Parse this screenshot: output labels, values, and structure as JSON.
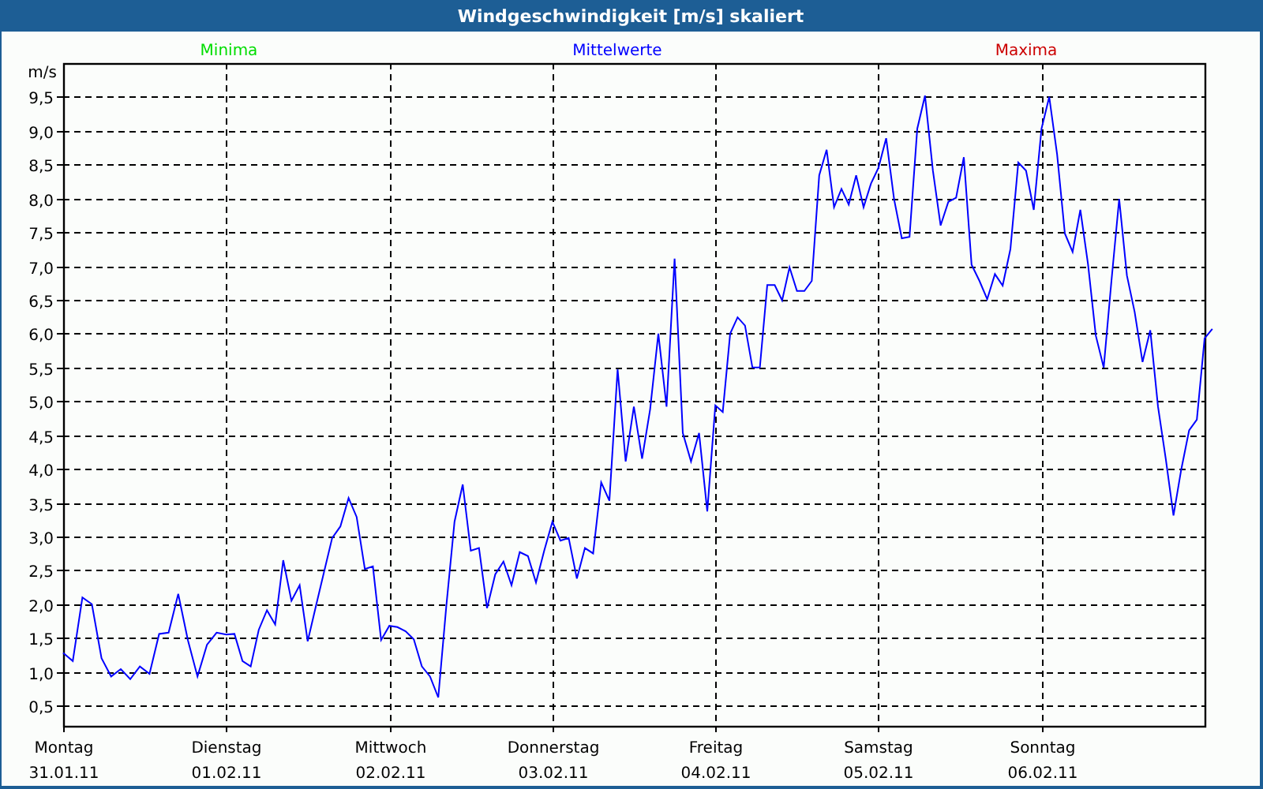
{
  "window": {
    "title": "Windgeschwindigkeit [m/s] skaliert"
  },
  "chart": {
    "legend": [
      {
        "name": "Minima",
        "color": "#00dd00"
      },
      {
        "name": "Mittelwerte",
        "color": "#0000ff"
      },
      {
        "name": "Maxima",
        "color": "#cc0000"
      }
    ],
    "dates": [
      "31.01.11",
      "01.02.11",
      "02.02.11",
      "03.02.11",
      "04.02.11",
      "05.02.11",
      "06.02.11"
    ],
    "chart_data": {
      "type": "line",
      "grid": true,
      "ylabel": "m/s",
      "ylim": [
        0.2,
        10
      ],
      "categories": [
        "Montag",
        null,
        null,
        null,
        null,
        null,
        null,
        null,
        null,
        null,
        null,
        null,
        null,
        null,
        null,
        null,
        null,
        "Dienstag",
        null,
        null,
        null,
        null,
        null,
        null,
        null,
        null,
        null,
        null,
        null,
        null,
        null,
        null,
        null,
        null,
        null,
        null,
        null,
        "Mittwoch",
        null,
        null,
        null,
        null,
        null,
        null,
        null,
        null,
        null,
        null,
        null,
        null,
        null,
        null,
        null,
        null,
        null,
        null,
        null,
        "Donnerstag",
        null,
        null,
        null,
        null,
        null,
        null,
        null,
        null,
        null,
        null,
        null,
        null,
        null,
        null,
        null,
        null,
        null,
        null,
        null,
        "Freitag",
        null,
        null,
        null,
        null,
        null,
        null,
        null,
        null,
        null,
        null,
        null,
        null,
        null,
        null,
        null,
        null,
        null,
        null,
        null,
        null,
        null,
        "Samstag",
        null,
        null,
        null,
        null,
        null,
        null,
        null,
        null,
        null,
        null,
        null,
        null,
        null,
        null,
        null,
        null,
        null,
        null,
        null,
        null,
        "Sonntag",
        null,
        null,
        null,
        null,
        null,
        null,
        null,
        null,
        null,
        null,
        null,
        null,
        null,
        null,
        null,
        null,
        null,
        null,
        null,
        null,
        null,
        null
      ],
      "yticks": [
        {
          "value": 0.5,
          "label": "0,5"
        },
        {
          "value": 1,
          "label": "1,0"
        },
        {
          "value": 1.5,
          "label": "1,5"
        },
        {
          "value": 2,
          "label": "2,0"
        },
        {
          "value": 2.5,
          "label": "2,5"
        },
        {
          "value": 3,
          "label": "3,0"
        },
        {
          "value": 3.5,
          "label": "3,5"
        },
        {
          "value": 4,
          "label": "4,0"
        },
        {
          "value": 4.5,
          "label": "4,5"
        },
        {
          "value": 5,
          "label": "5,0"
        },
        {
          "value": 5.5,
          "label": "5,5"
        },
        {
          "value": 6,
          "label": "6,0"
        },
        {
          "value": 6.5,
          "label": "6,5"
        },
        {
          "value": 7,
          "label": "7,0"
        },
        {
          "value": 7.5,
          "label": "7,5"
        },
        {
          "value": 8,
          "label": "8,0"
        },
        {
          "value": 8.5,
          "label": "8,5"
        },
        {
          "value": 9,
          "label": "9,0"
        },
        {
          "value": 9.5,
          "label": "9,5"
        }
      ],
      "series": [
        {
          "color": "#0000ff",
          "values": [
            1.28,
            1.16,
            2.1,
            2.0,
            1.2,
            0.93,
            1.04,
            0.89,
            1.08,
            0.97,
            1.56,
            1.58,
            2.15,
            1.47,
            0.93,
            1.4,
            1.58,
            1.55,
            1.56,
            1.16,
            1.08,
            1.62,
            1.91,
            1.7,
            2.65,
            2.05,
            2.28,
            1.45,
            1.97,
            2.48,
            2.98,
            3.15,
            3.57,
            3.29,
            2.52,
            2.56,
            1.47,
            1.68,
            1.66,
            1.6,
            1.48,
            1.08,
            0.93,
            0.62,
            1.97,
            3.22,
            3.77,
            2.79,
            2.83,
            1.94,
            2.44,
            2.63,
            2.28,
            2.77,
            2.71,
            2.32,
            2.79,
            3.22,
            2.94,
            2.98,
            2.38,
            2.83,
            2.75,
            3.8,
            3.53,
            5.47,
            4.11,
            4.92,
            4.15,
            4.88,
            6.0,
            4.92,
            7.11,
            4.53,
            4.11,
            4.53,
            3.37,
            4.94,
            4.84,
            6.0,
            6.24,
            6.12,
            5.5,
            5.5,
            6.72,
            6.72,
            6.49,
            6.98,
            6.63,
            6.63,
            6.78,
            8.34,
            8.72,
            7.87,
            8.14,
            7.91,
            8.34,
            7.87,
            8.22,
            8.45,
            8.89,
            7.99,
            7.41,
            7.43,
            9.03,
            9.52,
            8.41,
            7.6,
            7.95,
            8.01,
            8.61,
            7.02,
            6.78,
            6.51,
            6.88,
            6.71,
            7.25,
            8.53,
            8.41,
            7.83,
            9.03,
            9.5,
            8.65,
            7.48,
            7.21,
            7.83,
            7.02,
            5.97,
            5.5,
            6.78,
            7.99,
            6.86,
            6.32,
            5.58,
            6.05,
            4.92,
            4.15,
            3.31,
            3.99,
            4.57,
            4.73,
            5.93,
            6.07
          ]
        }
      ]
    }
  }
}
